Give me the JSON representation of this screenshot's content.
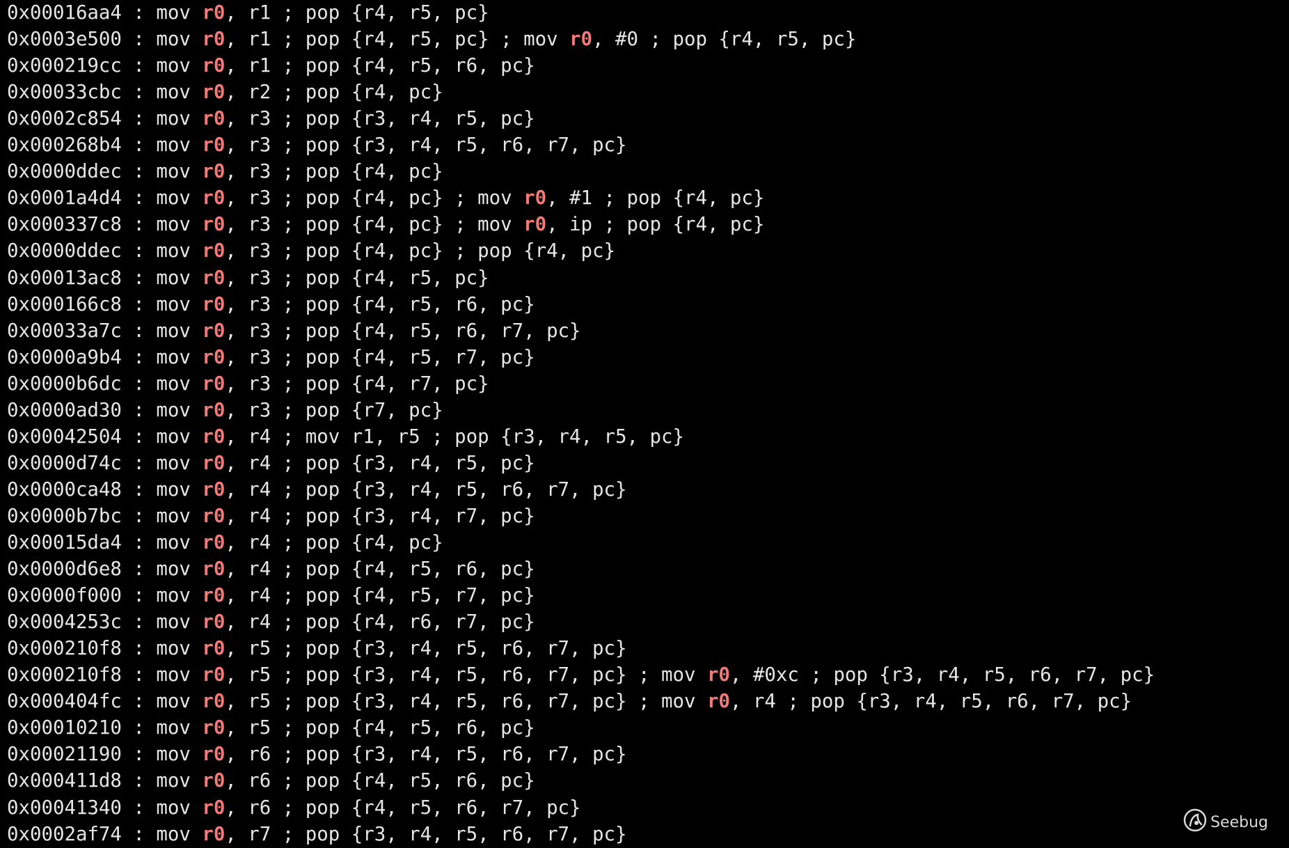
{
  "terminal": {
    "highlight_term": "r0",
    "highlight_color": "#f47a78",
    "text_color": "#e6e6e6",
    "background": "#000000",
    "lines": [
      "0x00016aa4 : mov r0, r1 ; pop {r4, r5, pc}",
      "0x0003e500 : mov r0, r1 ; pop {r4, r5, pc} ; mov r0, #0 ; pop {r4, r5, pc}",
      "0x000219cc : mov r0, r1 ; pop {r4, r5, r6, pc}",
      "0x00033cbc : mov r0, r2 ; pop {r4, pc}",
      "0x0002c854 : mov r0, r3 ; pop {r3, r4, r5, pc}",
      "0x000268b4 : mov r0, r3 ; pop {r3, r4, r5, r6, r7, pc}",
      "0x0000ddec : mov r0, r3 ; pop {r4, pc}",
      "0x0001a4d4 : mov r0, r3 ; pop {r4, pc} ; mov r0, #1 ; pop {r4, pc}",
      "0x000337c8 : mov r0, r3 ; pop {r4, pc} ; mov r0, ip ; pop {r4, pc}",
      "0x0000ddec : mov r0, r3 ; pop {r4, pc} ; pop {r4, pc}",
      "0x00013ac8 : mov r0, r3 ; pop {r4, r5, pc}",
      "0x000166c8 : mov r0, r3 ; pop {r4, r5, r6, pc}",
      "0x00033a7c : mov r0, r3 ; pop {r4, r5, r6, r7, pc}",
      "0x0000a9b4 : mov r0, r3 ; pop {r4, r5, r7, pc}",
      "0x0000b6dc : mov r0, r3 ; pop {r4, r7, pc}",
      "0x0000ad30 : mov r0, r3 ; pop {r7, pc}",
      "0x00042504 : mov r0, r4 ; mov r1, r5 ; pop {r3, r4, r5, pc}",
      "0x0000d74c : mov r0, r4 ; pop {r3, r4, r5, pc}",
      "0x0000ca48 : mov r0, r4 ; pop {r3, r4, r5, r6, r7, pc}",
      "0x0000b7bc : mov r0, r4 ; pop {r3, r4, r7, pc}",
      "0x00015da4 : mov r0, r4 ; pop {r4, pc}",
      "0x0000d6e8 : mov r0, r4 ; pop {r4, r5, r6, pc}",
      "0x0000f000 : mov r0, r4 ; pop {r4, r5, r7, pc}",
      "0x0004253c : mov r0, r4 ; pop {r4, r6, r7, pc}",
      "0x000210f8 : mov r0, r5 ; pop {r3, r4, r5, r6, r7, pc}",
      "0x000210f8 : mov r0, r5 ; pop {r3, r4, r5, r6, r7, pc} ; mov r0, #0xc ; pop {r3, r4, r5, r6, r7, pc}",
      "0x000404fc : mov r0, r5 ; pop {r3, r4, r5, r6, r7, pc} ; mov r0, r4 ; pop {r3, r4, r5, r6, r7, pc}",
      "0x00010210 : mov r0, r5 ; pop {r4, r5, r6, pc}",
      "0x00021190 : mov r0, r6 ; pop {r3, r4, r5, r6, r7, pc}",
      "0x000411d8 : mov r0, r6 ; pop {r4, r5, r6, pc}",
      "0x00041340 : mov r0, r6 ; pop {r4, r5, r6, r7, pc}",
      "0x0002af74 : mov r0, r7 ; pop {r3, r4, r5, r6, r7, pc}"
    ]
  },
  "watermark": {
    "text": "Seebug",
    "icon": "seebug-bug-icon"
  }
}
